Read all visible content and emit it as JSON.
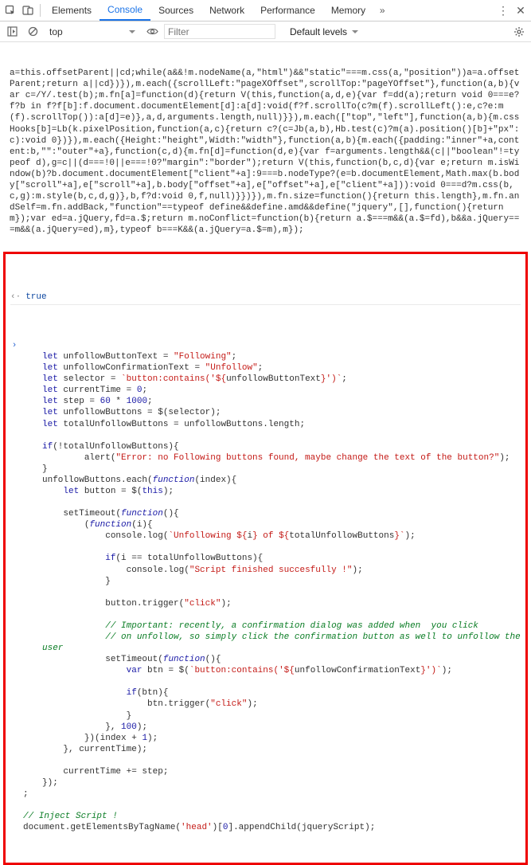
{
  "header": {
    "tabs": [
      "Elements",
      "Console",
      "Sources",
      "Network",
      "Performance",
      "Memory"
    ],
    "active_tab_index": 1
  },
  "toolbar": {
    "context_label": "top",
    "filter_placeholder": "Filter",
    "levels_label": "Default levels"
  },
  "log": {
    "minified": "a=this.offsetParent||cd;while(a&&!m.nodeName(a,\"html\")&&\"static\"===m.css(a,\"position\"))a=a.offsetParent;return a||cd})}),m.each({scrollLeft:\"pageXOffset\",scrollTop:\"pageYOffset\"},function(a,b){var c=/Y/.test(b);m.fn[a]=function(d){return V(this,function(a,d,e){var f=dd(a);return void 0===e?f?b in f?f[b]:f.document.documentElement[d]:a[d]:void(f?f.scrollTo(c?m(f).scrollLeft():e,c?e:m(f).scrollTop()):a[d]=e)},a,d,arguments.length,null)}}),m.each([\"top\",\"left\"],function(a,b){m.cssHooks[b]=Lb(k.pixelPosition,function(a,c){return c?(c=Jb(a,b),Hb.test(c)?m(a).position()[b]+\"px\":c):void 0})}),m.each({Height:\"height\",Width:\"width\"},function(a,b){m.each({padding:\"inner\"+a,content:b,\"\":\"outer\"+a},function(c,d){m.fn[d]=function(d,e){var f=arguments.length&&(c||\"boolean\"!=typeof d),g=c||(d===!0||e===!0?\"margin\":\"border\");return V(this,function(b,c,d){var e;return m.isWindow(b)?b.document.documentElement[\"client\"+a]:9===b.nodeType?(e=b.documentElement,Math.max(b.body[\"scroll\"+a],e[\"scroll\"+a],b.body[\"offset\"+a],e[\"offset\"+a],e[\"client\"+a])):void 0===d?m.css(b,c,g):m.style(b,c,d,g)},b,f?d:void 0,f,null)}})}),m.fn.size=function(){return this.length},m.fn.andSelf=m.fn.addBack,\"function\"==typeof define&&define.amd&&define(\"jquery\",[],function(){return m});var ed=a.jQuery,fd=a.$;return m.noConflict=function(b){return a.$===m&&(a.$=fd),b&&a.jQuery===m&&(a.jQuery=ed),m},typeof b===K&&(a.jQuery=a.$=m),m});"
  },
  "true_label": "true",
  "code": {
    "l1a": "let",
    "l1b": " unfollowButtonText = ",
    "l1c": "\"Following\"",
    "l2a": "let",
    "l2b": " unfollowConfirmationText = ",
    "l2c": "\"Unfollow\"",
    "l3a": "let",
    "l3b": " selector = ",
    "l3c": "`button:contains('${",
    "l3d": "unfollowButtonText",
    "l3e": "}')`",
    "l4a": "let",
    "l4b": " currentTime = ",
    "l4c": "0",
    "l5a": "let",
    "l5b": " step = ",
    "l5c": "60",
    "l5d": " * ",
    "l5e": "1000",
    "l6a": "let",
    "l6b": " unfollowButtons = $(selector);",
    "l7a": "let",
    "l7b": " totalUnfollowButtons = unfollowButtons.length;",
    "l8a": "if",
    "l8b": "(!totalUnfollowButtons){",
    "l9a": "        alert(",
    "l9b": "\"Error: no Following buttons found, maybe change the text of the button?\"",
    "l9c": ");",
    "l10": "}",
    "l11a": "unfollowButtons.each(",
    "l11b": "function",
    "l11c": "(index){",
    "l12a": "    let",
    "l12b": " button = $(",
    "l12c": "this",
    "l12d": ");",
    "l13a": "    setTimeout(",
    "l13b": "function",
    "l13c": "(){",
    "l14a": "        (",
    "l14b": "function",
    "l14c": "(i){",
    "l15a": "            console.log(",
    "l15b": "`Unfollowing ${",
    "l15c": "i",
    "l15d": "} of ${",
    "l15e": "totalUnfollowButtons",
    "l15f": "}`",
    "l15g": ");",
    "l16a": "            if",
    "l16b": "(i == totalUnfollowButtons){",
    "l17a": "                console.log(",
    "l17b": "\"Script finished succesfully !\"",
    "l17c": ");",
    "l18": "            }",
    "l19a": "            button.trigger(",
    "l19b": "\"click\"",
    "l19c": ");",
    "c1": "            // Important: recently, a confirmation dialog was added when  you click",
    "c2": "            // on unfollow, so simply click the confirmation button as well to unfollow the user",
    "l20a": "            setTimeout(",
    "l20b": "function",
    "l20c": "(){",
    "l21a": "                var",
    "l21b": " btn = $(",
    "l21c": "`button:contains('${",
    "l21d": "unfollowConfirmationText",
    "l21e": "}')`",
    "l21f": ");",
    "l22a": "                if",
    "l22b": "(btn){",
    "l23a": "                    btn.trigger(",
    "l23b": "\"click\"",
    "l23c": ");",
    "l24": "                }",
    "l25a": "            }, ",
    "l25b": "100",
    "l25c": ");",
    "l26a": "        })(index + ",
    "l26b": "1",
    "l26c": ");",
    "l27": "    }, currentTime);",
    "l28": "    currentTime += step;",
    "l29": "});",
    "semi": ";",
    "inj": "// Inject Script !",
    "last1": "document.getElementsByTagName(",
    "last2": "'head'",
    "last3": ")[",
    "last4": "0",
    "last5": "].appendChild(jqueryScript);"
  }
}
